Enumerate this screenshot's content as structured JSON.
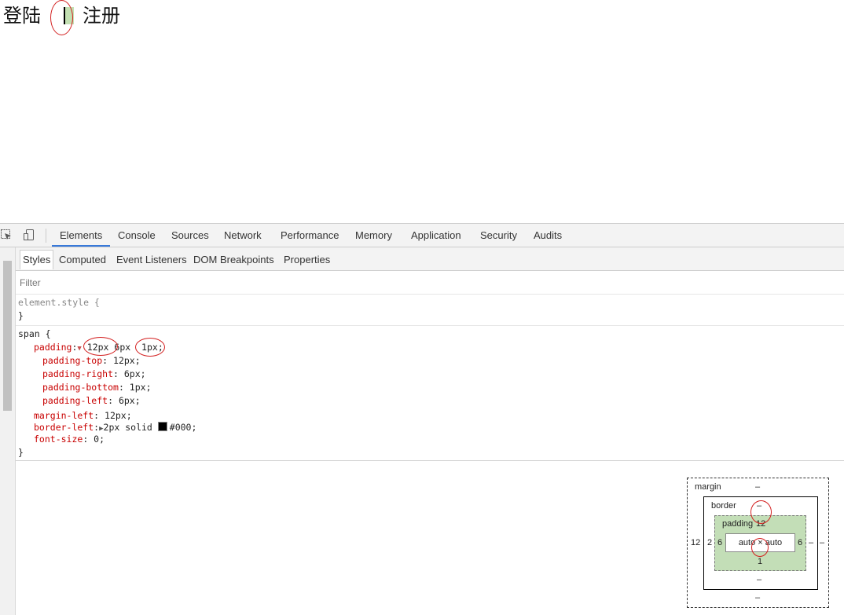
{
  "page": {
    "login_text": "登陆",
    "register_text": "注册"
  },
  "devtools": {
    "main_tabs": [
      "Elements",
      "Console",
      "Sources",
      "Network",
      "Performance",
      "Memory",
      "Application",
      "Security",
      "Audits"
    ],
    "active_tab": "Elements",
    "sub_tabs": [
      "Styles",
      "Computed",
      "Event Listeners",
      "DOM Breakpoints",
      "Properties"
    ],
    "active_sub_tab": "Styles",
    "filter_placeholder": "Filter",
    "element_style": {
      "selector": "element.style {",
      "close": "}"
    },
    "span_rule": {
      "selector": "span {",
      "close": "}",
      "padding_prop": "padding",
      "padding_v1": "12px",
      "padding_v2": "6px",
      "padding_v3": "1px;",
      "longhands": [
        {
          "prop": "padding-top",
          "value": "12px;"
        },
        {
          "prop": "padding-right",
          "value": "6px;"
        },
        {
          "prop": "padding-bottom",
          "value": "1px;"
        },
        {
          "prop": "padding-left",
          "value": "6px;"
        }
      ],
      "margin_left_prop": "margin-left",
      "margin_left_value": "12px;",
      "border_left_prop": "border-left",
      "border_left_value_pre": "2px solid ",
      "border_left_color": "#000;",
      "font_size_prop": "font-size",
      "font_size_value": "0;"
    },
    "box_model": {
      "margin_label": "margin",
      "margin_top": "–",
      "margin_bottom": "–",
      "margin_left": "12",
      "margin_right": "–",
      "border_label": "border",
      "border_top": "–",
      "border_bottom": "–",
      "border_left": "2",
      "border_right": "–",
      "padding_label": "padding",
      "padding_top": "12",
      "padding_bottom": "1",
      "padding_left": "6",
      "padding_right": "6",
      "content": "auto × auto"
    }
  },
  "colors": {
    "annotation": "#d32020",
    "padding_green": "#c3deb7",
    "tab_accent": "#3879d9",
    "css_property": "#c80000"
  }
}
